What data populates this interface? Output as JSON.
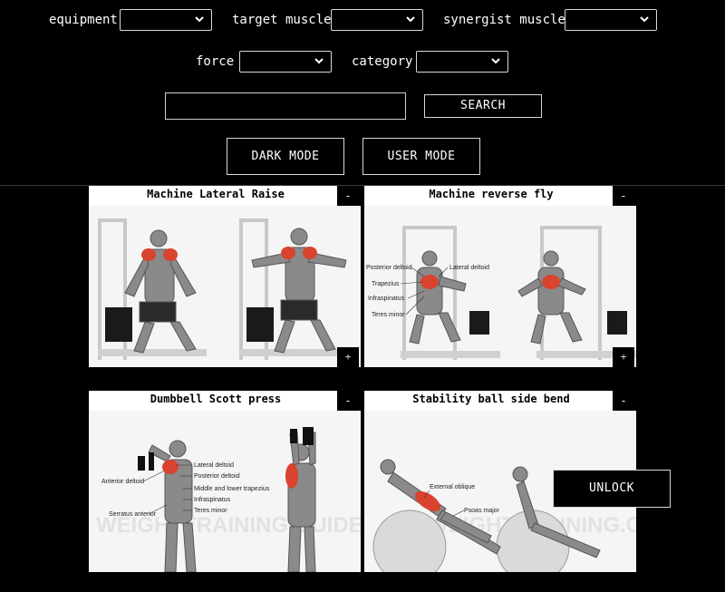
{
  "filters": {
    "equipment_label": "equipment",
    "target_label": "target muscle",
    "synergist_label": "synergist muscle",
    "force_label": "force",
    "category_label": "category",
    "search_button": "SEARCH",
    "search_value": "",
    "dark_mode_button": "DARK MODE",
    "user_mode_button": "USER MODE"
  },
  "cards": [
    {
      "title": "Machine Lateral Raise",
      "collapse": "-",
      "expand": "+"
    },
    {
      "title": "Machine reverse fly",
      "collapse": "-",
      "expand": "+",
      "labels": [
        "Posterior deltoid",
        "Lateral deltoid",
        "Trapezius",
        "Infraspinatus",
        "Teres minor"
      ]
    },
    {
      "title": "Dumbbell Scott press",
      "collapse": "-",
      "expand": "+",
      "labels": [
        "Lateral deltoid",
        "Posterior deltoid",
        "Anterior deltoid",
        "Middle and lower trapezius",
        "Infraspinatus",
        "Teres minor",
        "Serratus anterior"
      ],
      "watermark": "WEIGHTTRAINING.GUIDE"
    },
    {
      "title": "Stability ball side bend",
      "collapse": "-",
      "expand": "+",
      "labels": [
        "External oblique",
        "Psoas major"
      ],
      "watermark": "WEIGHTTRAINING.GUIDE"
    }
  ],
  "unlock_button": "UNLOCK",
  "colors": {
    "background": "#000000",
    "text": "#ffffff",
    "muscle_highlight": "#d9432f"
  }
}
